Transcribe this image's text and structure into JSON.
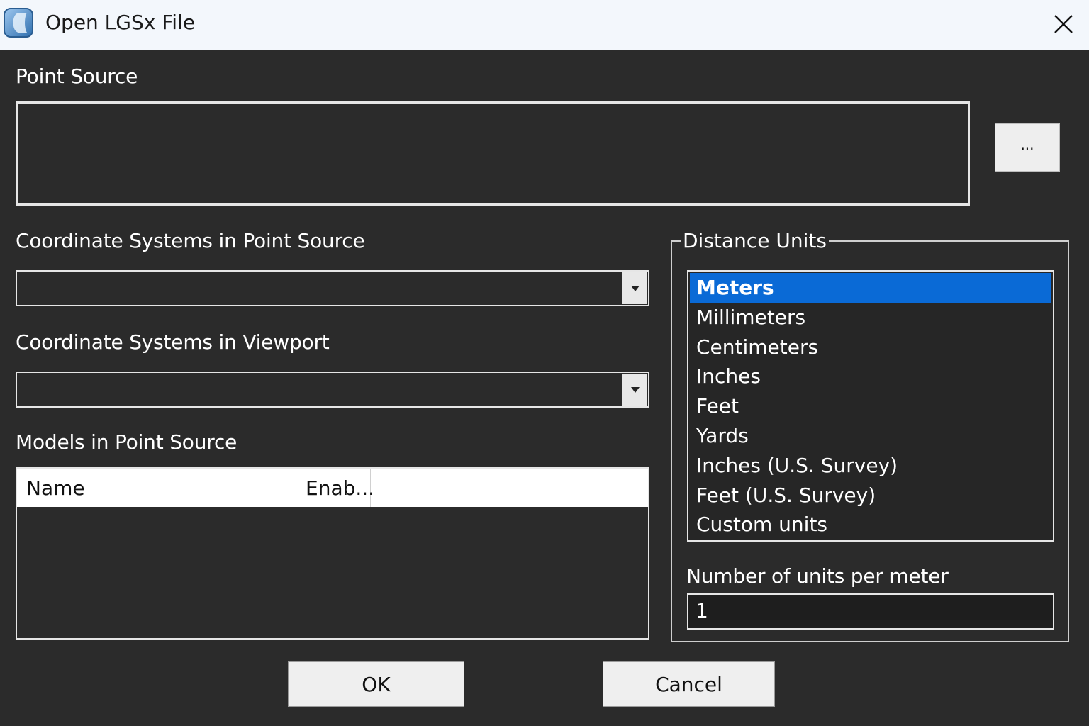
{
  "window": {
    "title": "Open LGSx File",
    "icon": "app-icon",
    "close_icon": "close-icon"
  },
  "point_source": {
    "label": "Point Source",
    "value": "",
    "browse_label": "..."
  },
  "coord_point_source": {
    "label": "Coordinate Systems in Point Source",
    "selected": ""
  },
  "coord_viewport": {
    "label": "Coordinate Systems in Viewport",
    "selected": ""
  },
  "models": {
    "label": "Models in Point Source",
    "columns": [
      "Name",
      "Enab..."
    ],
    "rows": []
  },
  "distance_units": {
    "legend": "Distance Units",
    "items": [
      "Meters",
      "Millimeters",
      "Centimeters",
      "Inches",
      "Feet",
      "Yards",
      "Inches (U.S. Survey)",
      "Feet (U.S. Survey)",
      "Custom units"
    ],
    "selected": "Meters",
    "units_per_meter_label": "Number of units per meter",
    "units_per_meter_value": "1"
  },
  "buttons": {
    "ok": "OK",
    "cancel": "Cancel"
  },
  "colors": {
    "background": "#2b2b2b",
    "titlebar": "#f3f7fc",
    "selection": "#0a6ad6"
  }
}
